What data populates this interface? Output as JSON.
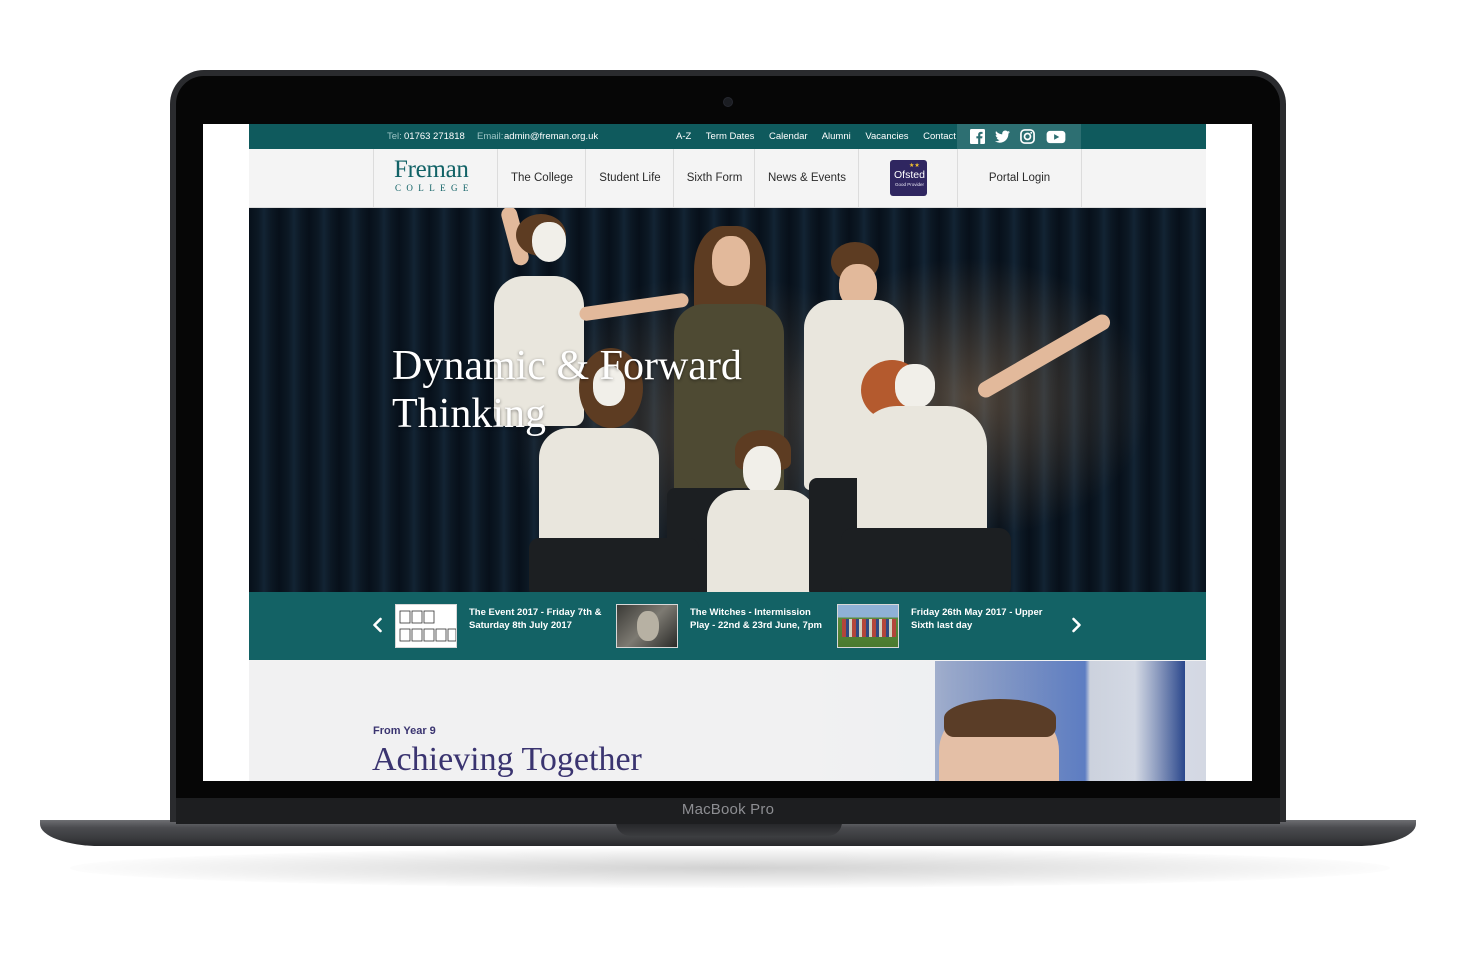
{
  "device": {
    "label": "MacBook Pro"
  },
  "topbar": {
    "tel_label": "Tel:",
    "tel_value": "01763 271818",
    "email_label": "Email:",
    "email_value": "admin@freman.org.uk",
    "links": [
      "A-Z",
      "Term Dates",
      "Calendar",
      "Alumni",
      "Vacancies",
      "Contact"
    ],
    "social_icons": [
      "facebook-icon",
      "twitter-icon",
      "instagram-icon",
      "youtube-icon"
    ]
  },
  "logo": {
    "name": "Freman",
    "subtitle": "COLLEGE",
    "color": "#116266"
  },
  "nav": {
    "items": [
      "The College",
      "Student Life",
      "Sixth Form",
      "News & Events"
    ],
    "ofsted": {
      "name": "Ofsted",
      "rating": "Good Provider"
    },
    "portal_login": "Portal Login"
  },
  "hero": {
    "title": "Dynamic & Forward Thinking"
  },
  "news": [
    {
      "title": "The Event 2017 - Friday 7th & Saturday 8th July 2017",
      "thumb_text": "the event"
    },
    {
      "title": "The Witches - Intermission Play - 22nd & 23rd June, 7pm"
    },
    {
      "title": "Friday 26th May 2017 - Upper Sixth last day"
    }
  ],
  "section": {
    "eyebrow": "From Year 9",
    "title": "Achieving Together"
  },
  "colors": {
    "brand_teal": "#0f5a5d",
    "strip_teal": "#136265",
    "heading_purple": "#3a3470",
    "ofsted_purple": "#2f2660"
  }
}
